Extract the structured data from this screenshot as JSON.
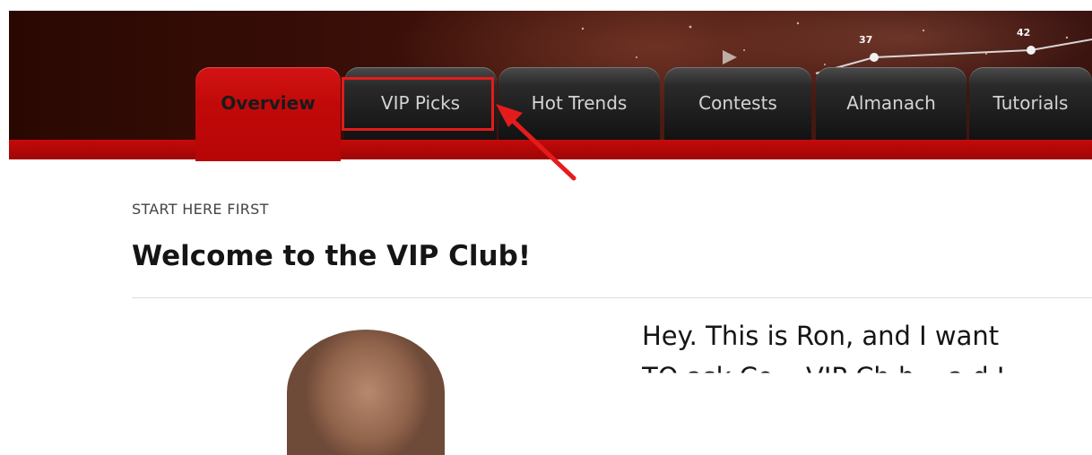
{
  "nav": {
    "tabs": [
      {
        "label": "Overview",
        "active": true
      },
      {
        "label": "VIP Picks",
        "active": false,
        "highlighted": true
      },
      {
        "label": "Hot Trends",
        "active": false
      },
      {
        "label": "Contests",
        "active": false
      },
      {
        "label": "Almanach",
        "active": false
      },
      {
        "label": "Tutorials",
        "active": false
      }
    ]
  },
  "header": {
    "chart_markers": [
      "37",
      "42"
    ]
  },
  "content": {
    "kicker": "START HERE FIRST",
    "title": "Welcome to the VIP Club!",
    "intro_line1": "Hey. This is Ron, and I want",
    "intro_line2": "TO ask Co... VIP Ch.b... a d I"
  },
  "colors": {
    "brand_red": "#c40a0a",
    "highlight": "#e51b1b",
    "tab_dark": "#1a1a1a"
  },
  "icons": {
    "annotation_arrow": "arrow-icon",
    "player_photo": "avatar"
  }
}
